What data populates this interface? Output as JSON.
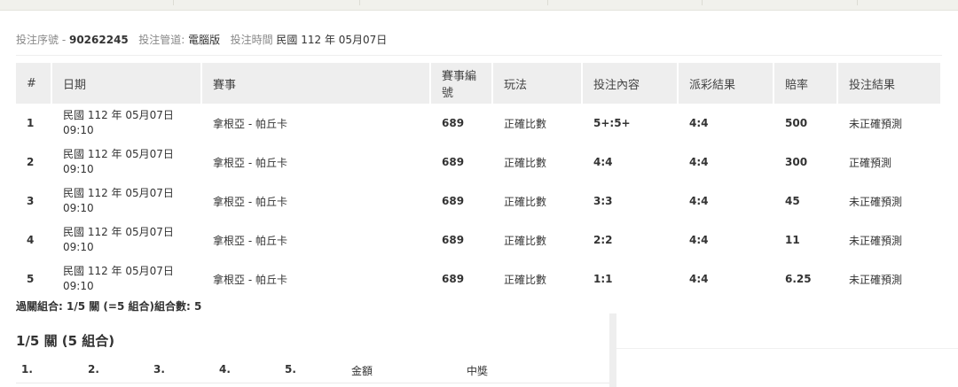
{
  "bet_info": {
    "serial_label": "投注序號 -",
    "serial_value": "90262245",
    "channel_label": "投注管道:",
    "channel_value": "電腦版",
    "time_label": "投注時間",
    "time_value": "民國 112 年 05月07日"
  },
  "table": {
    "headers": [
      "#",
      "日期",
      "賽事",
      "賽事編號",
      "玩法",
      "投注內容",
      "派彩結果",
      "賠率",
      "投注結果"
    ],
    "header_event_no_line1": "賽事編",
    "header_event_no_line2": "號",
    "rows": [
      {
        "idx": "1",
        "date_line1": "民國 112 年 05月07日",
        "date_line2": "09:10",
        "match": "拿根亞 - 帕丘卡",
        "event_no": "689",
        "play": "正確比數",
        "selection": "5+:5+",
        "result": "4:4",
        "odds": "500",
        "outcome": "未正確預測"
      },
      {
        "idx": "2",
        "date_line1": "民國 112 年 05月07日",
        "date_line2": "09:10",
        "match": "拿根亞 - 帕丘卡",
        "event_no": "689",
        "play": "正確比數",
        "selection": "4:4",
        "result": "4:4",
        "odds": "300",
        "outcome": "正確預測"
      },
      {
        "idx": "3",
        "date_line1": "民國 112 年 05月07日",
        "date_line2": "09:10",
        "match": "拿根亞 - 帕丘卡",
        "event_no": "689",
        "play": "正確比數",
        "selection": "3:3",
        "result": "4:4",
        "odds": "45",
        "outcome": "未正確預測"
      },
      {
        "idx": "4",
        "date_line1": "民國 112 年 05月07日",
        "date_line2": "09:10",
        "match": "拿根亞 - 帕丘卡",
        "event_no": "689",
        "play": "正確比數",
        "selection": "2:2",
        "result": "4:4",
        "odds": "11",
        "outcome": "未正確預測"
      },
      {
        "idx": "5",
        "date_line1": "民國 112 年 05月07日",
        "date_line2": "09:10",
        "match": "拿根亞 - 帕丘卡",
        "event_no": "689",
        "play": "正確比數",
        "selection": "1:1",
        "result": "4:4",
        "odds": "6.25",
        "outcome": "未正確預測"
      }
    ]
  },
  "combo_summary": "過關組合: 1/5 關 (=5 組合)組合數: 5",
  "section_title": "1/5 關 (5 組合)",
  "combo_columns": [
    "1.",
    "2.",
    "3.",
    "4.",
    "5.",
    "金額",
    "中獎"
  ]
}
